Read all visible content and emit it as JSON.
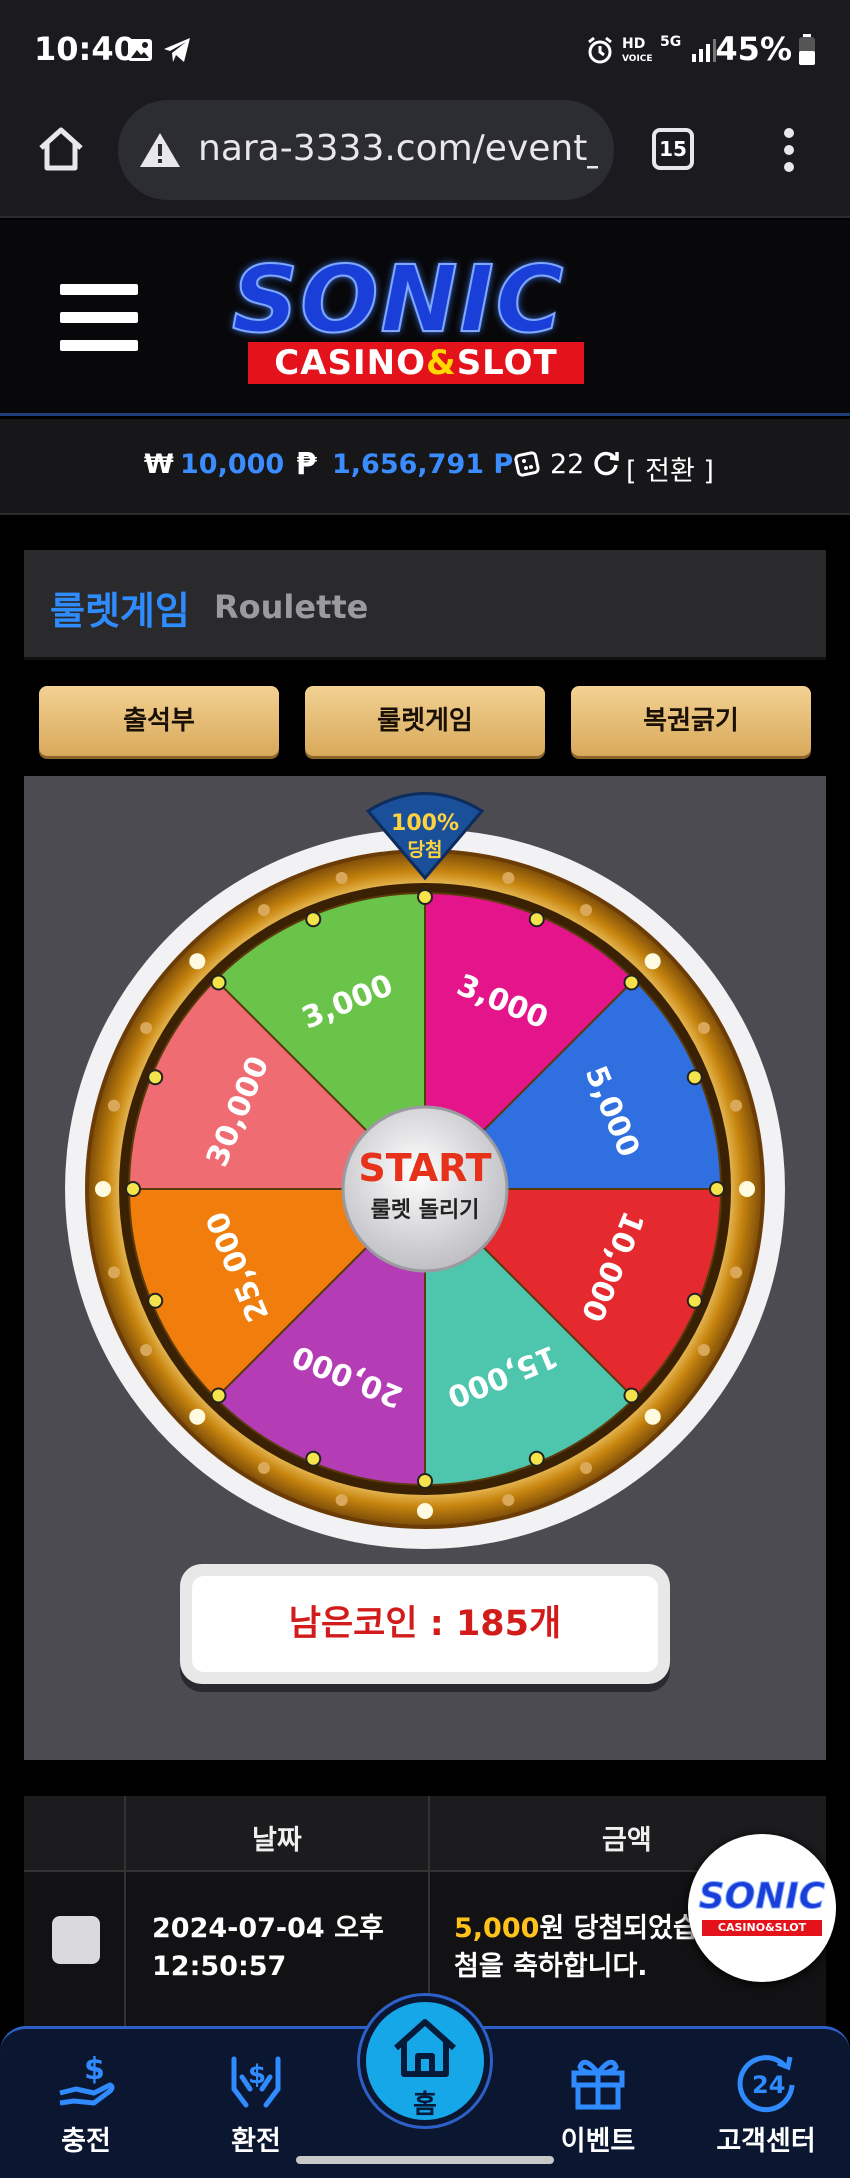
{
  "status_bar": {
    "time": "10:40",
    "battery": "45%",
    "network": "5G",
    "hd_voice": "HD"
  },
  "browser": {
    "url": "nara-3333.com/event_",
    "tab_count": "15"
  },
  "site": {
    "logo_main": "SONIC",
    "logo_sub_left": "CASINO",
    "logo_sub_amp": "&",
    "logo_sub_right": "SLOT"
  },
  "balance": {
    "won_symbol": "₩",
    "won": "10,000",
    "point_symbol": "₱",
    "points": "1,656,791 P",
    "dice_count": "22",
    "swap_label": "[ 전환 ]"
  },
  "section": {
    "title_ko": "룰렛게임",
    "title_en": "Roulette"
  },
  "tabs": [
    {
      "label": "출석부"
    },
    {
      "label": "룰렛게임"
    },
    {
      "label": "복권긁기"
    }
  ],
  "roulette": {
    "badge_top": "100%",
    "badge_bottom": "당첨",
    "start_label": "START",
    "start_sub": "룰렛 돌리기",
    "segments": [
      {
        "label": "3,000",
        "color": "#e4158a"
      },
      {
        "label": "5,000",
        "color": "#2f6fe0"
      },
      {
        "label": "10,000",
        "color": "#e52a2f"
      },
      {
        "label": "15,000",
        "color": "#4dc6ad"
      },
      {
        "label": "20,000",
        "color": "#b43db5"
      },
      {
        "label": "25,000",
        "color": "#f07d0c"
      },
      {
        "label": "30,000",
        "color": "#ef6d72"
      },
      {
        "label": "3,000",
        "color": "#6bc44a"
      }
    ],
    "coins_label": "남은코인 : 185개"
  },
  "history": {
    "headers": [
      "날짜",
      "금액"
    ],
    "rows": [
      {
        "date_line1": "2024-07-04 오후",
        "date_line2": "12:50:57",
        "amount": "5,000",
        "text_line1": "원 당첨되었습",
        "text_line2": "첨을 축하합니다."
      }
    ]
  },
  "floating_logo": {
    "main": "SONIC",
    "sub": "CASINO&SLOT"
  },
  "bottom_nav": [
    {
      "label": "충전"
    },
    {
      "label": "환전"
    },
    {
      "label": "홈"
    },
    {
      "label": "이벤트"
    },
    {
      "label": "고객센터"
    }
  ],
  "colors": {
    "accent_blue": "#2e8cff",
    "gold": "#e0b460",
    "win_red": "#d21b1b",
    "amount_yellow": "#ffc21a"
  }
}
